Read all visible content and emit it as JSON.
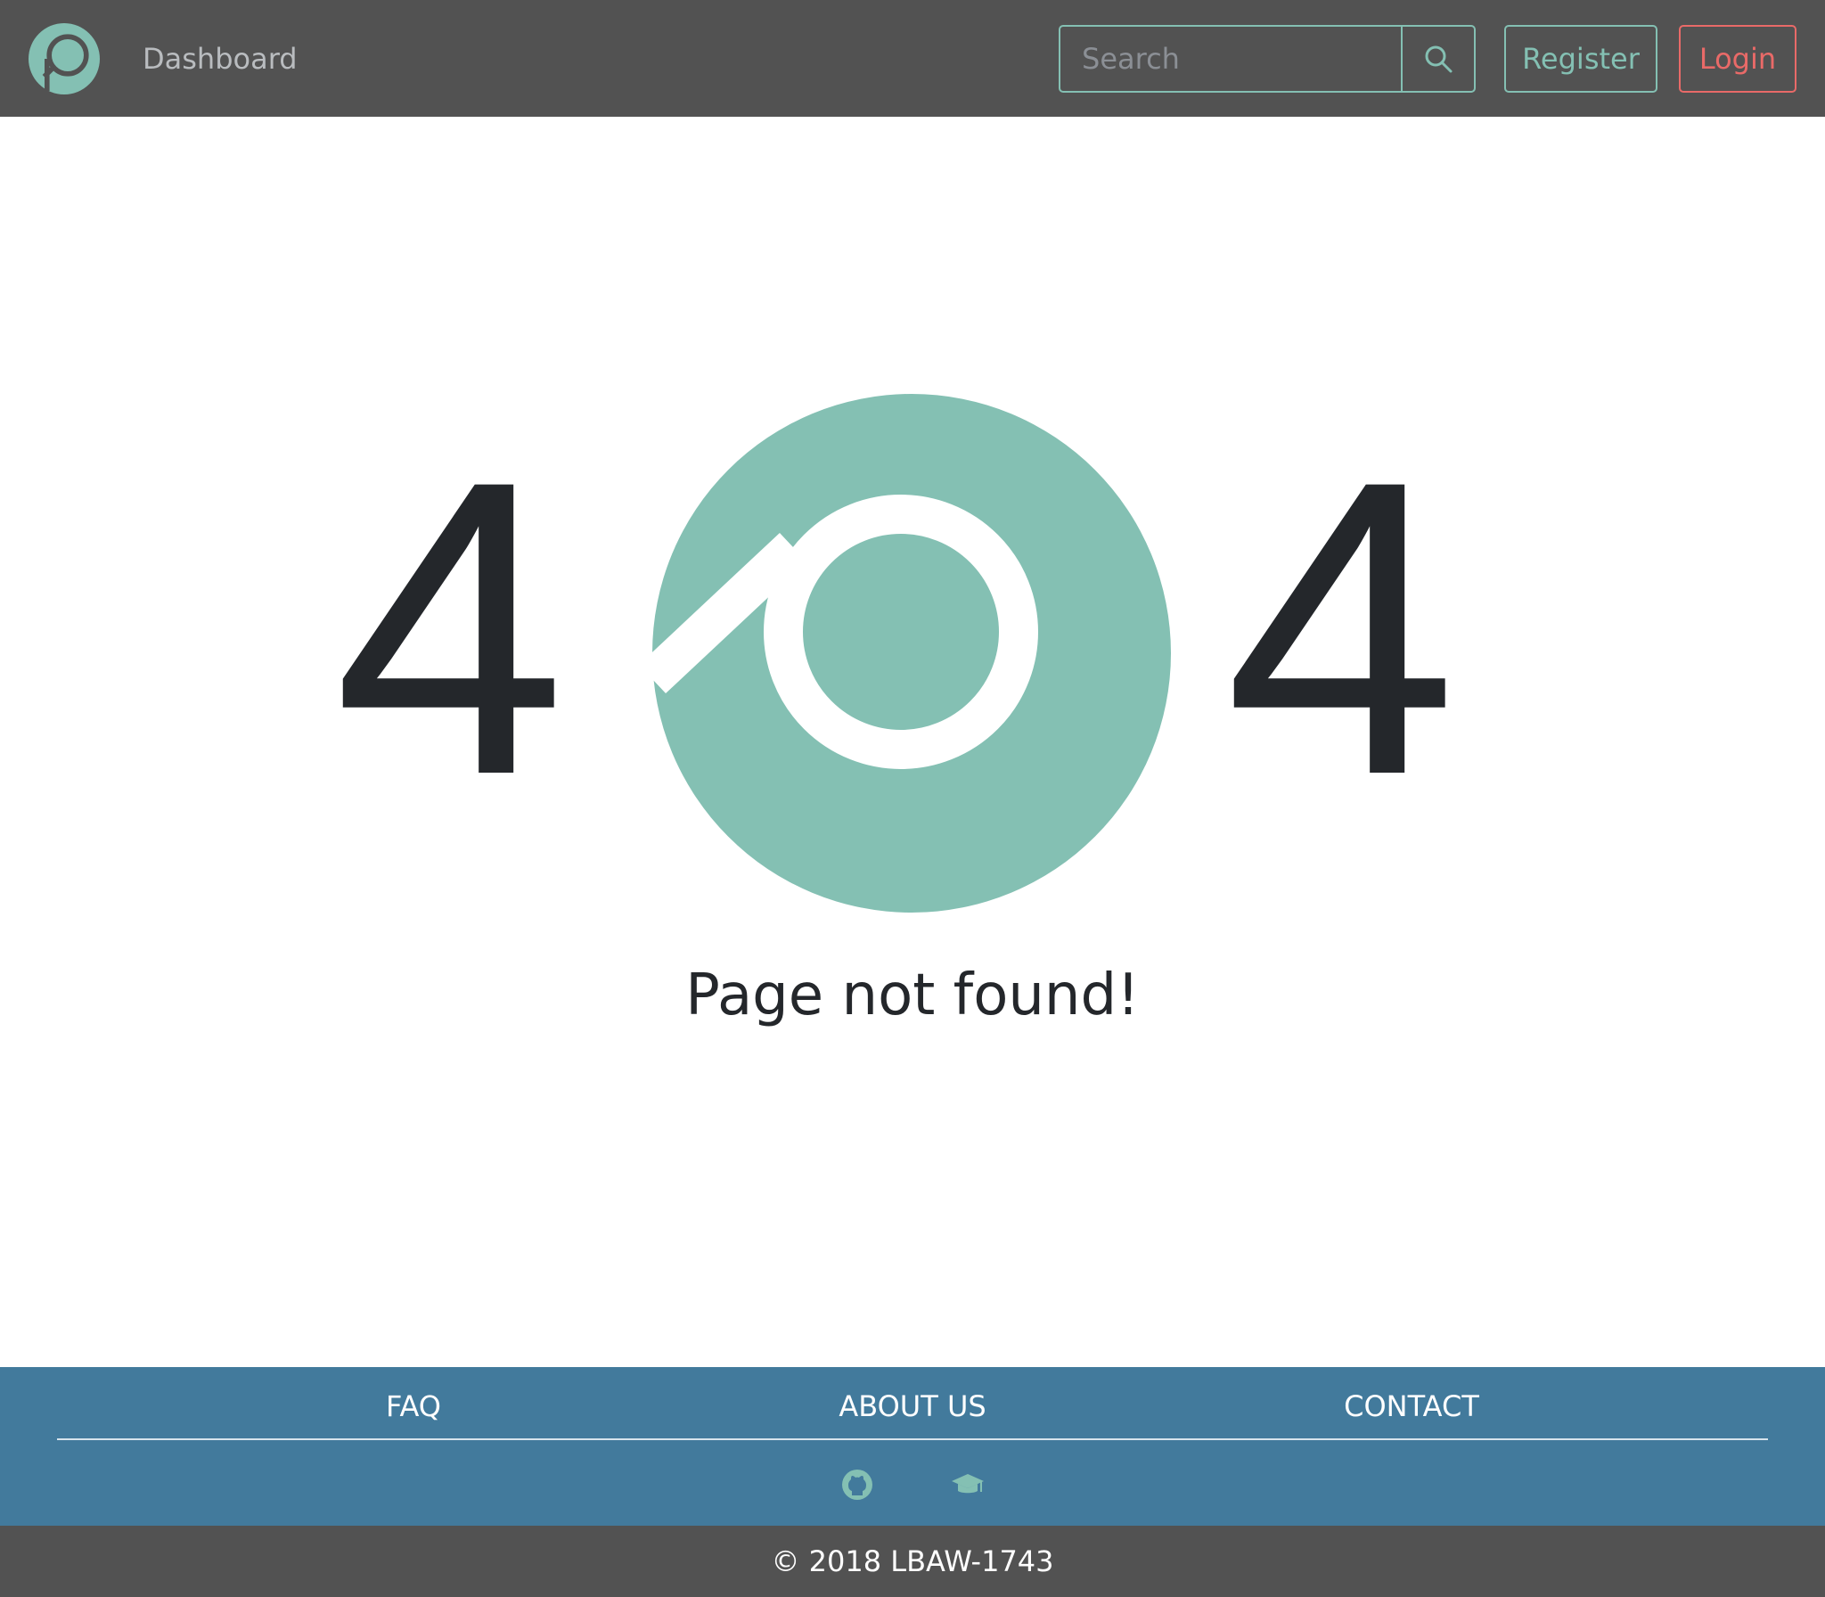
{
  "navbar": {
    "logo": "brand-p-logo",
    "dashboard_label": "Dashboard",
    "search": {
      "placeholder": "Search",
      "value": "",
      "button_icon": "search-icon"
    },
    "register_label": "Register",
    "login_label": "Login"
  },
  "main": {
    "digit_left": "4",
    "digit_right": "4",
    "center_graphic": "brand-p-logo",
    "message": "Page not found!"
  },
  "footer": {
    "links": [
      {
        "label": "FAQ"
      },
      {
        "label": "ABOUT US"
      },
      {
        "label": "CONTACT"
      }
    ],
    "icons": [
      "github-icon",
      "graduation-cap-icon"
    ],
    "copyright": "© 2018 LBAW-1743"
  },
  "colors": {
    "navbar_bg": "#525252",
    "accent_teal": "#84c0b3",
    "login_red": "#e96a68",
    "footer_bg": "#427a9c",
    "text_dark": "#24272b"
  }
}
